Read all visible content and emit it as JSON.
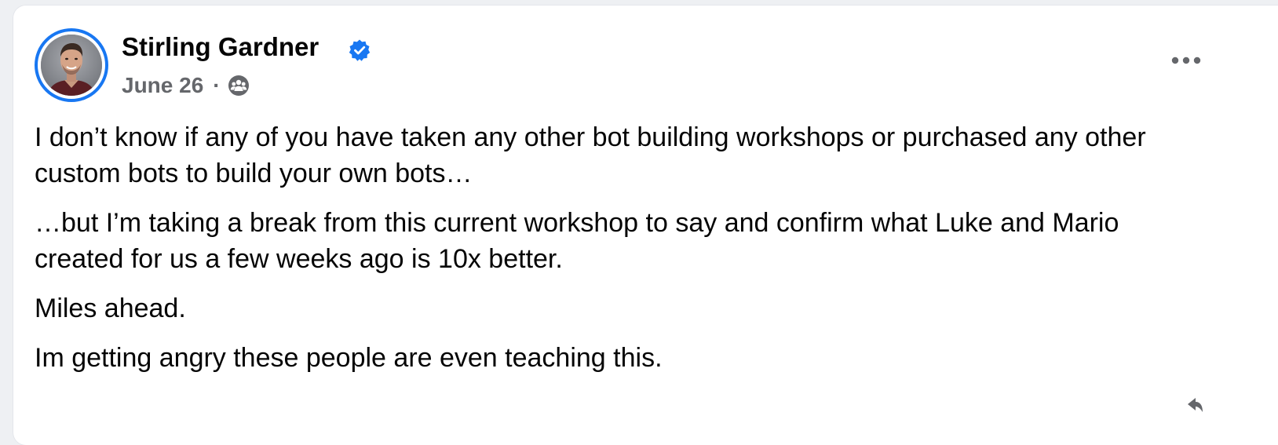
{
  "post": {
    "author": {
      "name": "Stirling Gardner",
      "verified": true,
      "avatar": "avatar-photo"
    },
    "date": "June 26",
    "separator": "·",
    "audience_icon": "group-audience-icon",
    "more_icon": "more-options-icon",
    "paragraphs": [
      {
        "line1": "I don’t know if any of you have taken any other bot building workshops or purchased any other",
        "line2": "custom bots to build your own bots…"
      },
      {
        "line1": "…but I’m taking a break from this current workshop to say and confirm what Luke and Mario",
        "line2": "created for us a few weeks ago is 10x better."
      },
      {
        "line1": "Miles ahead."
      },
      {
        "line1": "Im getting angry these people are even teaching this."
      }
    ]
  },
  "colors": {
    "accent": "#1877f2",
    "secondary_text": "#65676b",
    "primary_text": "#050505",
    "background": "#eef0f3",
    "card": "#ffffff"
  }
}
